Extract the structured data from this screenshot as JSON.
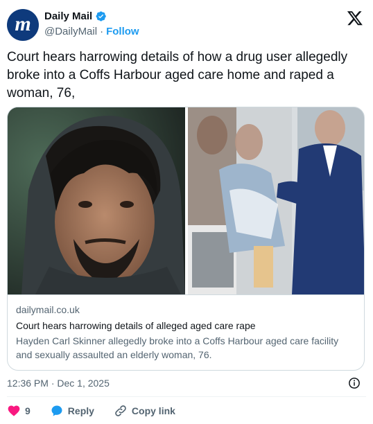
{
  "author": {
    "name": "Daily Mail",
    "handle": "@DailyMail",
    "separator": "·",
    "follow_label": "Follow",
    "avatar_letter": "m",
    "avatar_color": "#0e3a7c",
    "verified_color": "#1d9bf0",
    "verified_icon": "verified-badge-icon"
  },
  "tweet": {
    "text": "Court hears harrowing details of how a drug user allegedly broke into a Coffs Harbour aged care home and raped a woman, 76,"
  },
  "card": {
    "domain": "dailymail.co.uk",
    "title": "Court hears harrowing details of alleged aged care rape",
    "description": "Hayden Carl Skinner allegedly broke into a Coffs Harbour aged care facility and sexually assaulted an elderly woman, 76."
  },
  "meta": {
    "timestamp": "12:36 PM · Dec 1, 2025",
    "info_icon": "info-icon"
  },
  "actions": {
    "like_count": "9",
    "like_color": "#f91880",
    "reply_label": "Reply",
    "copy_link_label": "Copy link"
  }
}
